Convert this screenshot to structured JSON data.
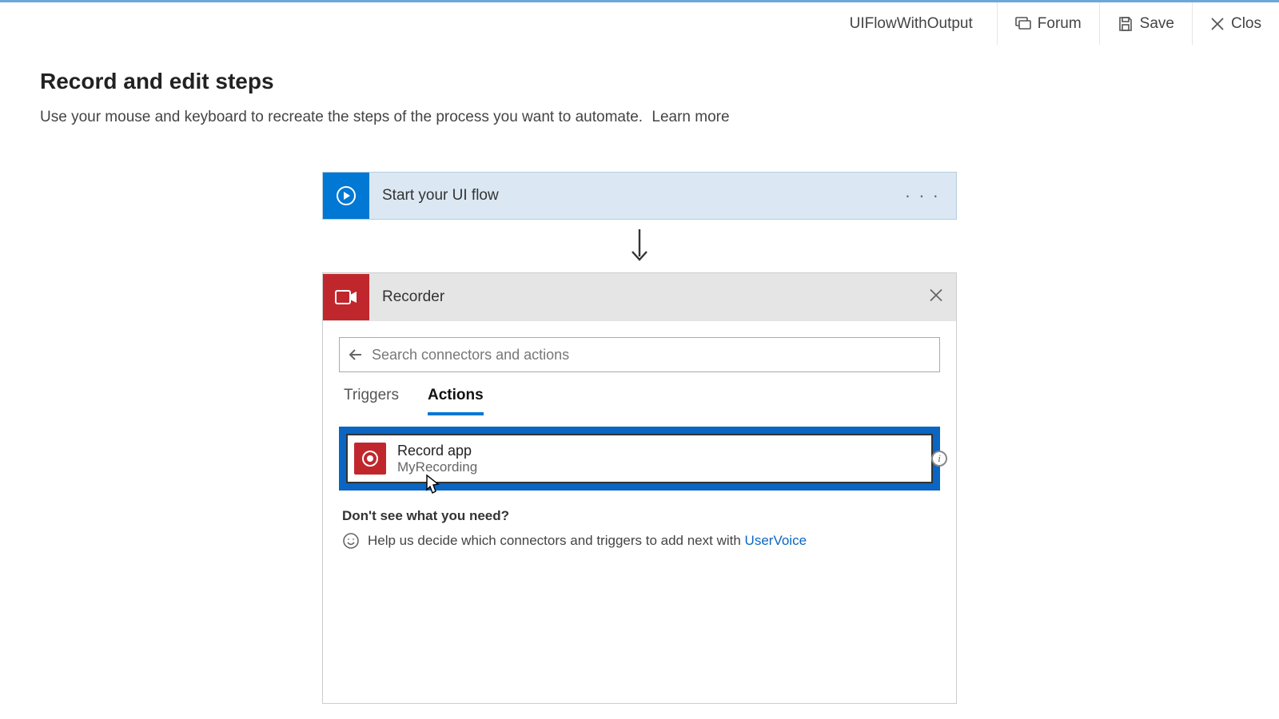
{
  "topbar": {
    "flow_name": "UIFlowWithOutput",
    "forum_label": "Forum",
    "save_label": "Save",
    "close_label": "Clos"
  },
  "page": {
    "title": "Record and edit steps",
    "description": "Use your mouse and keyboard to recreate the steps of the process you want to automate.",
    "learn_more": "Learn more"
  },
  "start_step": {
    "label": "Start your UI flow",
    "more": "· · ·"
  },
  "recorder": {
    "title": "Recorder",
    "search_placeholder": "Search connectors and actions",
    "tabs": {
      "triggers": "Triggers",
      "actions": "Actions"
    },
    "action": {
      "title": "Record app",
      "subtitle": "MyRecording"
    },
    "need_title": "Don't see what you need?",
    "need_help": "Help us decide which connectors and triggers to add next with ",
    "uservoice": "UserVoice",
    "info_badge": "i"
  }
}
